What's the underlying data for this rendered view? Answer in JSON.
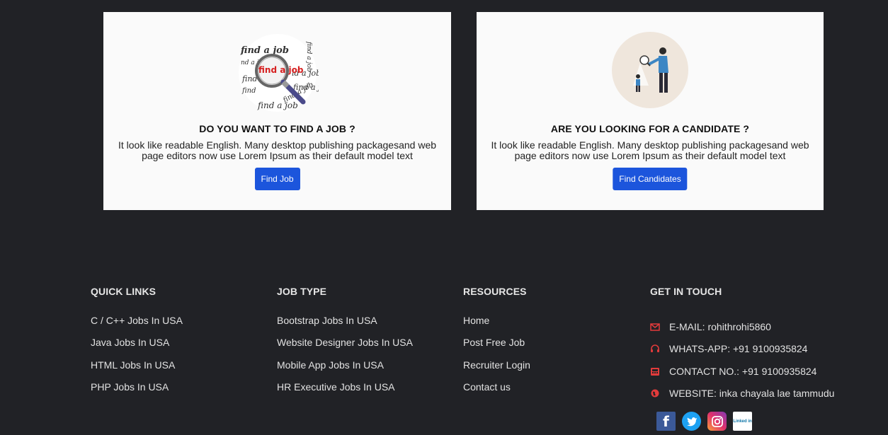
{
  "cards": [
    {
      "title": "DO YOU WANT TO FIND A JOB ?",
      "text": "It look like readable English. Many desktop publishing packagesand web page editors now use Lorem Ipsum as their default model text",
      "button": "Find Job",
      "image_text": "find a job"
    },
    {
      "title": "ARE YOU LOOKING FOR A CANDIDATE ?",
      "text": "It look like readable English. Many desktop publishing packagesand web page editors now use Lorem Ipsum as their default model text",
      "button": "Find Candidates"
    }
  ],
  "footer": {
    "quick_links": {
      "heading": "QUICK LINKS",
      "items": [
        "C / C++ Jobs In USA",
        "Java Jobs In USA",
        "HTML Jobs In USA",
        "PHP Jobs In USA"
      ]
    },
    "job_type": {
      "heading": "JOB TYPE",
      "items": [
        "Bootstrap Jobs In USA",
        "Website Designer Jobs In USA",
        "Mobile App Jobs In USA",
        "HR Executive Jobs In USA"
      ]
    },
    "resources": {
      "heading": "RESOURCES",
      "items": [
        "Home",
        "Post Free Job",
        "Recruiter Login",
        "Contact us"
      ]
    },
    "get_in_touch": {
      "heading": "GET IN TOUCH",
      "items": [
        {
          "icon": "envelope-icon",
          "text": "E-MAIL: rohithrohi5860"
        },
        {
          "icon": "headphones-icon",
          "text": "WHATS-APP: +91 9100935824"
        },
        {
          "icon": "phone-icon",
          "text": "CONTACT NO.: +91 9100935824"
        },
        {
          "icon": "globe-icon",
          "text": "WEBSITE: inka chayala lae tammudu"
        }
      ]
    },
    "social": [
      {
        "icon": "facebook-icon",
        "glyph": "f"
      },
      {
        "icon": "twitter-icon",
        "glyph": ""
      },
      {
        "icon": "instagram-icon",
        "glyph": ""
      },
      {
        "icon": "linkedin-icon",
        "glyph": "Linked in"
      }
    ]
  },
  "colors": {
    "background": "#212226",
    "button": "#1c55dc",
    "contact_icon": "#e23b3b"
  }
}
